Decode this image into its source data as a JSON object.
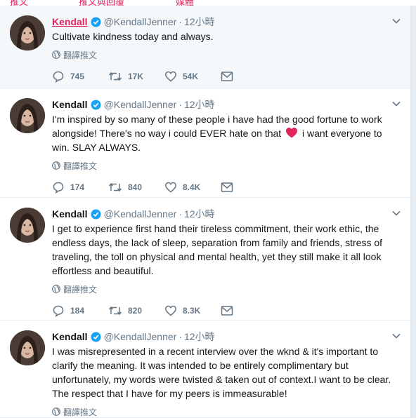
{
  "top_strip": [
    "推文",
    "推文與回覆",
    "媒體"
  ],
  "colors": {
    "accent": "#1da1f2",
    "highlight_name": "#e0245e",
    "muted": "#657786",
    "emoji_heart": "#e0245e"
  },
  "tweets": [
    {
      "name": "Kendall",
      "handle": "@KendallJenner",
      "dot": "·",
      "time": "12小時",
      "text": "Cultivate kindness today and always.",
      "translate": "翻譯推文",
      "replies": "745",
      "retweets": "17K",
      "likes": "54K",
      "highlighted": true
    },
    {
      "name": "Kendall",
      "handle": "@KendallJenner",
      "dot": "·",
      "time": "12小時",
      "text_before": "I'm inspired by so many of these people i have had the good fortune to work alongside! There's no way i could EVER hate on that ",
      "text_after": " i want everyone to win. SLAY ALWAYS.",
      "emoji": "red-heart-emoji",
      "translate": "翻譯推文",
      "replies": "174",
      "retweets": "840",
      "likes": "8.4K"
    },
    {
      "name": "Kendall",
      "handle": "@KendallJenner",
      "dot": "·",
      "time": "12小時",
      "text": "I get to experience first hand their tireless commitment, their work ethic, the endless days, the lack of sleep, separation from family and friends, stress of traveling, the toll on physical and mental health, yet they still make it all look effortless and beautiful.",
      "translate": "翻譯推文",
      "replies": "184",
      "retweets": "820",
      "likes": "8.3K"
    },
    {
      "name": "Kendall",
      "handle": "@KendallJenner",
      "dot": "·",
      "time": "12小時",
      "text": "I was misrepresented in a recent interview over the wknd & it's important to clarify the meaning. It was intended to be entirely complimentary but unfortunately, my words were twisted & taken out of context.I want to be clear. The respect that I have for my peers is immeasurable!",
      "translate": "翻譯推文"
    }
  ]
}
